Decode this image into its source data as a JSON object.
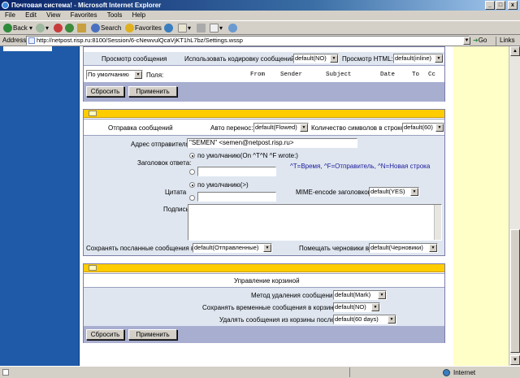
{
  "window": {
    "title": "Почтовая система! - Microsoft Internet Explorer",
    "min": "_",
    "max": "□",
    "close": "x"
  },
  "menu": [
    "File",
    "Edit",
    "View",
    "Favorites",
    "Tools",
    "Help"
  ],
  "toolbar": {
    "back": "Back",
    "search": "Search",
    "favorites": "Favorites"
  },
  "address": {
    "label": "Address",
    "url": "http://netpost.risp.ru:8100/Session/6-cNewvulQcaVjKT1hL7bz/Settings.wssp",
    "go": "Go",
    "links": "Links"
  },
  "view_panel": {
    "header_label": "Просмотр сообщения",
    "encoding_label": "Использовать кодировку сообщений:",
    "encoding_value": "default(NO)",
    "html_label": "Просмотр HTML:",
    "html_value": "default(inline)",
    "sort_value": "По умолчанию",
    "fields_label": "Поля:",
    "columns": [
      "From",
      "Sender",
      "Subject",
      "Date",
      "To",
      "Cc"
    ],
    "reset": "Сбросить",
    "apply": "Применить"
  },
  "send_panel": {
    "header_label": "Отправка сообщений",
    "wrap_label": "Авто перенос:",
    "wrap_value": "default(Flowed)",
    "linelen_label": "Количество символов в строке:",
    "linelen_value": "default(60)",
    "from_label": "Адрес отправителя:",
    "from_value": "\"SEMEN\" <semen@netpost.risp.ru>",
    "reply_label": "Заголовок ответа:",
    "reply_default": "по умолчанию(On ^T^N ^F wrote:)",
    "reply_hint": "^T=Время, ^F=Отправитель, ^N=Новая строка",
    "quote_label": "Цитата",
    "quote_default": "по умолчанию(>)",
    "mime_label": "MIME-encode заголовков:",
    "mime_value": "default(YES)",
    "signature_label": "Подпись:",
    "save_sent_label": "Сохранять посланные сообщения в",
    "save_sent_value": "default(Отправленные)",
    "drafts_label": "Помещать черновики в",
    "drafts_value": "default(Черновики)"
  },
  "trash_panel": {
    "header_label": "Управление корзиной",
    "delete_method_label": "Метод удаления сообщений:",
    "delete_method_value": "default(Mark)",
    "save_temp_label": "Сохранять временные сообщения в корзине:",
    "save_temp_value": "default(NO)",
    "purge_label": "Удалять сообщения из корзины после:",
    "purge_value": "default(60 days)",
    "reset": "Сбросить",
    "apply": "Применить"
  },
  "status": {
    "zone": "Internet"
  }
}
